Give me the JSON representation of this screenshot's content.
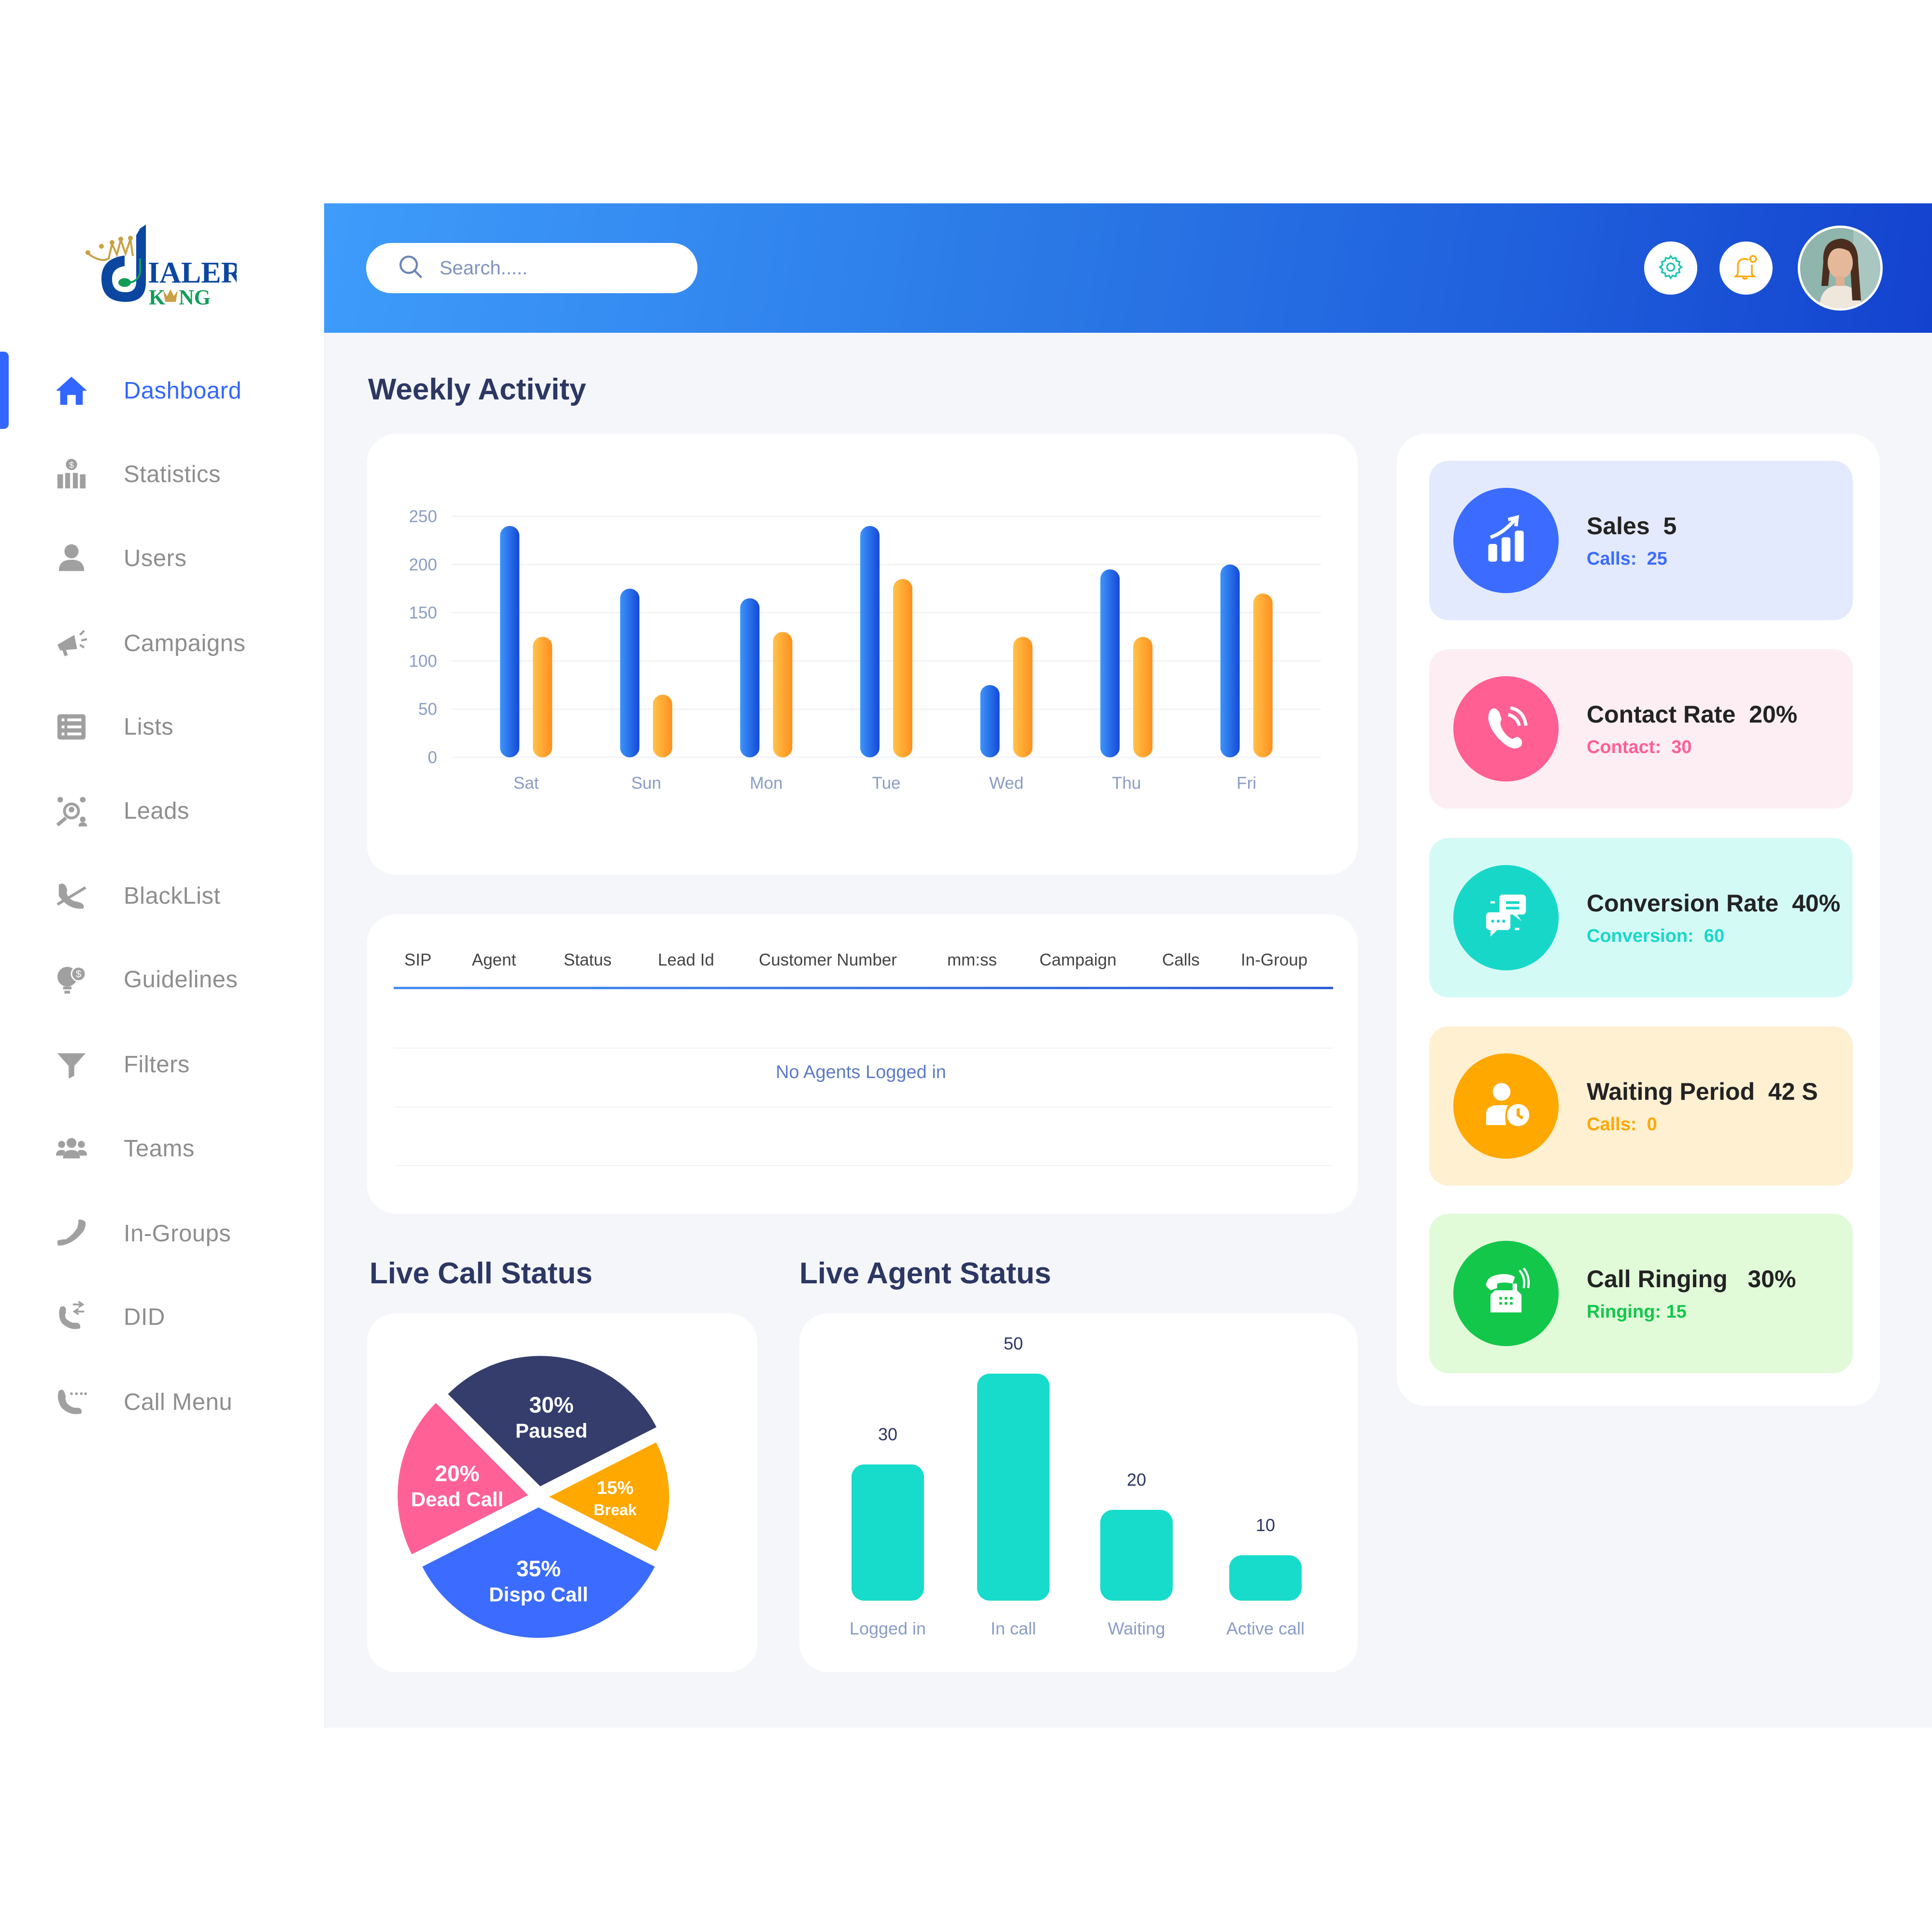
{
  "logo": {
    "word1": "IALER",
    "word2_left": "K",
    "word2_right": "NG",
    "colors": {
      "blue": "#0b47a1",
      "green": "#0f9d58",
      "gold": "#c9a043"
    }
  },
  "sidebar": {
    "active_index": 0,
    "items": [
      {
        "label": "Dashboard",
        "icon": "home-icon"
      },
      {
        "label": "Statistics",
        "icon": "statistics-icon"
      },
      {
        "label": "Users",
        "icon": "user-icon"
      },
      {
        "label": "Campaigns",
        "icon": "megaphone-icon"
      },
      {
        "label": "Lists",
        "icon": "list-icon"
      },
      {
        "label": "Leads",
        "icon": "leads-icon"
      },
      {
        "label": "BlackList",
        "icon": "blocked-call-icon"
      },
      {
        "label": "Guidelines",
        "icon": "lightbulb-dollar-icon"
      },
      {
        "label": "Filters",
        "icon": "filter-icon"
      },
      {
        "label": "Teams",
        "icon": "team-icon"
      },
      {
        "label": "In-Groups",
        "icon": "phone-icon"
      },
      {
        "label": "DID",
        "icon": "phone-transfer-icon"
      },
      {
        "label": "Call Menu",
        "icon": "phone-menu-icon"
      }
    ]
  },
  "header": {
    "search": {
      "placeholder": "Search.....",
      "value": ""
    },
    "settings_icon": "gear-icon",
    "notifications_icon": "bell-icon",
    "avatar_icon": "user-avatar"
  },
  "weekly_activity": {
    "title": "Weekly Activity"
  },
  "agents_table": {
    "columns": [
      "SIP",
      "Agent",
      "Status",
      "Lead Id",
      "Customer Number",
      "mm:ss",
      "Campaign",
      "Calls",
      "In-Group"
    ],
    "empty_message": "No Agents Logged in"
  },
  "live_call_status": {
    "title": "Live Call Status"
  },
  "live_agent_status": {
    "title": "Live Agent Status"
  },
  "stats": [
    {
      "title": "Sales  5",
      "sub": "Calls:  25",
      "icon": "chart-growth-icon",
      "accent": "#3b6cff",
      "bg": "#e4eafd"
    },
    {
      "title": "Contact Rate  20%",
      "sub": "Contact:  30",
      "icon": "phone-ringing-icon",
      "accent": "#ff5f93",
      "bg": "#fdeef4"
    },
    {
      "title": "Conversion Rate  40%",
      "sub": "Conversion:  60",
      "icon": "chat-bubbles-icon",
      "accent": "#17d8c8",
      "bg": "#d4faf6"
    },
    {
      "title": "Waiting Period  42 S",
      "sub": "Calls:  0",
      "icon": "user-clock-icon",
      "accent": "#ffa800",
      "bg": "#fff0d2"
    },
    {
      "title": "Call Ringing   30%",
      "sub": "Ringing: 15",
      "icon": "telephone-icon",
      "accent": "#13c74b",
      "bg": "#e1fbd9"
    }
  ],
  "chart_data": [
    {
      "type": "bar",
      "title": "Weekly Activity",
      "categories": [
        "Sat",
        "Sun",
        "Mon",
        "Tue",
        "Wed",
        "Thu",
        "Fri"
      ],
      "series": [
        {
          "name": "Series 1 (blue)",
          "color": "#2563eb",
          "values": [
            240,
            175,
            165,
            240,
            75,
            195,
            200
          ]
        },
        {
          "name": "Series 2 (orange)",
          "color": "#ffa22e",
          "values": [
            125,
            65,
            130,
            185,
            125,
            125,
            170
          ]
        }
      ],
      "yticks": [
        0,
        50,
        100,
        150,
        200,
        250
      ],
      "ylim": [
        0,
        250
      ],
      "xlabel": "",
      "ylabel": "",
      "grid": true,
      "legend": "none"
    },
    {
      "type": "pie",
      "title": "Live Call Status",
      "slices": [
        {
          "label": "Paused",
          "value": 30,
          "display": "30%",
          "color": "#343d6b"
        },
        {
          "label": "Break",
          "value": 15,
          "display": "15%",
          "color": "#ffa800"
        },
        {
          "label": "Dispo Call",
          "value": 35,
          "display": "35%",
          "color": "#3b6cff"
        },
        {
          "label": "Dead Call",
          "value": 20,
          "display": "20%",
          "color": "#ff6196"
        }
      ]
    },
    {
      "type": "bar",
      "title": "Live Agent Status",
      "categories": [
        "Logged in",
        "In call",
        "Waiting",
        "Active call"
      ],
      "values": [
        30,
        50,
        20,
        10
      ],
      "color": "#17dccb",
      "ylim": [
        0,
        55
      ],
      "data_labels": true,
      "grid": false
    }
  ]
}
